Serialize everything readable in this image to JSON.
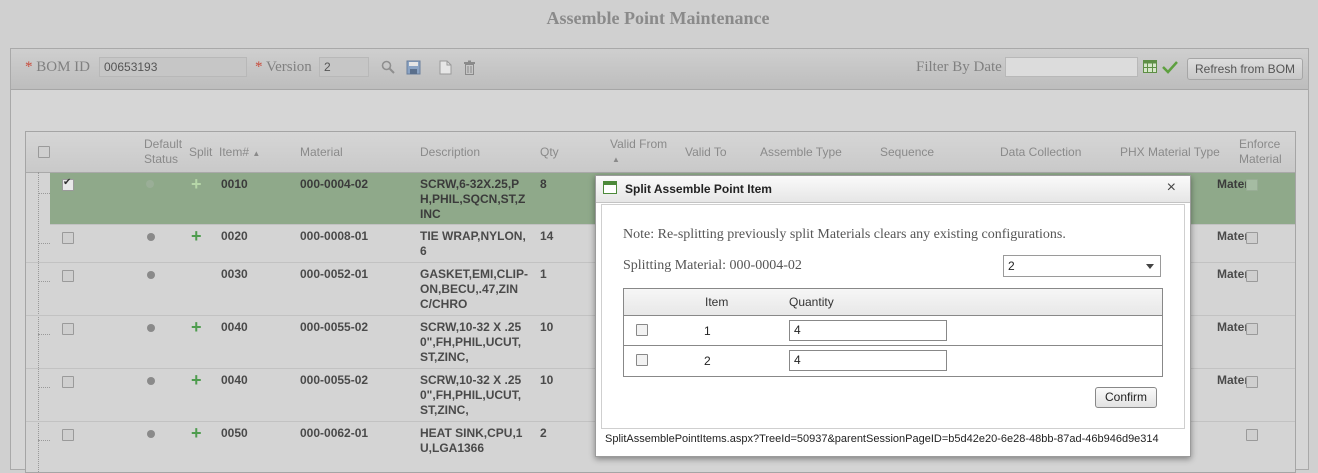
{
  "page": {
    "title": "Assemble Point Maintenance"
  },
  "toolbar": {
    "required_mark": "*",
    "bom_id_label": "BOM ID",
    "bom_id_value": "00653193",
    "version_label": "Version",
    "version_value": "2",
    "filter_label": "Filter By Date",
    "filter_value": "",
    "refresh_label": "Refresh from BOM"
  },
  "grid": {
    "headers": {
      "default_status": "Default Status",
      "split": "Split",
      "item": "Item#",
      "material": "Material",
      "description": "Description",
      "qty": "Qty",
      "valid_from": "Valid From",
      "valid_to": "Valid To",
      "assemble_type": "Assemble Type",
      "sequence": "Sequence",
      "data_collection": "Data Collection",
      "phx_material_type": "PHX Material Type",
      "enforce_material": "Enforce Material"
    },
    "rows": [
      {
        "item": "0010",
        "material": "000-0004-02",
        "description": "SCRW,6-32X.25,PH,PHIL,SQCN,ST,ZINC",
        "qty": "8",
        "phx": "Mater",
        "checked": true,
        "selected": true
      },
      {
        "item": "0020",
        "material": "000-0008-01",
        "description": "TIE WRAP,NYLON,6",
        "qty": "14",
        "phx": "Mater"
      },
      {
        "item": "0030",
        "material": "000-0052-01",
        "description": "GASKET,EMI,CLIP-ON,BECU,.47,ZINC/CHRO",
        "qty": "1",
        "phx": "Mater"
      },
      {
        "item": "0040",
        "material": "000-0055-02",
        "description": "SCRW,10-32 X .250\",FH,PHIL,UCUT,ST,ZINC,",
        "qty": "10",
        "phx": "Mater"
      },
      {
        "item": "0040",
        "material": "000-0055-02",
        "description": "SCRW,10-32 X .250\",FH,PHIL,UCUT,ST,ZINC,",
        "qty": "10",
        "phx": "Mater"
      },
      {
        "item": "0050",
        "material": "000-0062-01",
        "description": "HEAT SINK,CPU,1U,LGA1366",
        "qty": "2",
        "phx": ""
      }
    ]
  },
  "dialog": {
    "title": "Split Assemble Point Item",
    "close": "×",
    "note": "Note: Re-splitting previously split Materials clears any existing configurations.",
    "splitting_label": "Splitting Material:",
    "splitting_value": "000-0004-02",
    "split_count": "2",
    "table_headers": {
      "item": "Item",
      "quantity": "Quantity"
    },
    "items": [
      {
        "item": "1",
        "quantity": "4"
      },
      {
        "item": "2",
        "quantity": "4"
      }
    ],
    "confirm_label": "Confirm",
    "status_url": "SplitAssemblePointItems.aspx?TreeId=50937&parentSessionPageID=b5d42e20-6e28-48bb-87ad-46b946d9e314"
  },
  "colors": {
    "selected_row": "#8fa98a",
    "plus": "#4e9c4e",
    "required": "#c84a3a"
  },
  "icons": [
    "search-icon",
    "save-icon",
    "new-document-icon",
    "trash-icon",
    "calendar-icon",
    "checkmark-icon",
    "sort-ascending-icon",
    "plus-icon",
    "status-dot-icon",
    "close-icon",
    "dialog-window-icon",
    "dropdown-caret-icon"
  ]
}
